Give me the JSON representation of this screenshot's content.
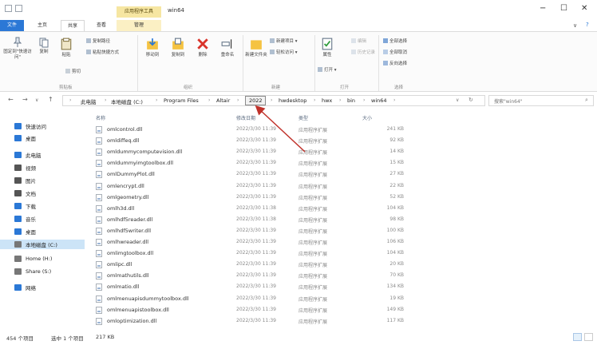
{
  "window": {
    "title": "win64",
    "context_tab": "应用程序工具",
    "minimize": "−",
    "maximize": "☐",
    "close": "✕",
    "collapse": "∨",
    "help": "?"
  },
  "ribbon_tabs": [
    {
      "label": "文件"
    },
    {
      "label": "主页"
    },
    {
      "label": "共享"
    },
    {
      "label": "查看"
    },
    {
      "label": "管理"
    }
  ],
  "ribbon": {
    "pin_label": "固定到\"快速访问\"",
    "copy_label": "复制",
    "paste_label": "粘贴",
    "copy_path": "复制路径",
    "paste_shortcut": "粘贴快捷方式",
    "cut": "剪切",
    "clipboard_group": "剪贴板",
    "move_to": "移动到",
    "copy_to": "复制到",
    "delete": "删除",
    "rename": "重命名",
    "organize_group": "组织",
    "new_folder": "新建文件夹",
    "new_item": "新建项目",
    "easy_access": "轻松访问",
    "new_group": "新建",
    "properties": "属性",
    "open": "打开",
    "edit": "编辑",
    "history": "历史记录",
    "open_group": "打开",
    "select_all": "全部选择",
    "select_none": "全部取消",
    "invert_selection": "反向选择",
    "select_group": "选择"
  },
  "address": {
    "crumbs": [
      "此电脑",
      "本地磁盘 (C:)",
      "Program Files",
      "Altair",
      "2022",
      "hwdesktop",
      "hwx",
      "bin",
      "win64"
    ],
    "search_placeholder": "搜索\"win64\"",
    "highlighted_crumb": "2022"
  },
  "nav_pane": [
    {
      "label": "快速访问",
      "icon": "star-icon",
      "color": "#2b78d6"
    },
    {
      "label": "桌面",
      "icon": "desktop-icon",
      "color": "#2b78d6"
    },
    {
      "label": "此电脑",
      "icon": "computer-icon",
      "color": "#2b78d6"
    },
    {
      "label": "视频",
      "icon": "video-icon",
      "color": "#555555"
    },
    {
      "label": "图片",
      "icon": "picture-icon",
      "color": "#555555"
    },
    {
      "label": "文档",
      "icon": "document-icon",
      "color": "#555555"
    },
    {
      "label": "下载",
      "icon": "download-icon",
      "color": "#2b78d6"
    },
    {
      "label": "音乐",
      "icon": "music-icon",
      "color": "#2b78d6"
    },
    {
      "label": "桌面",
      "icon": "desktop-icon",
      "color": "#2b78d6"
    },
    {
      "label": "本地磁盘 (C:)",
      "icon": "drive-icon",
      "color": "#777777"
    },
    {
      "label": "Home (H:)",
      "icon": "network-drive-icon",
      "color": "#777777"
    },
    {
      "label": "Share (S:)",
      "icon": "network-drive-icon",
      "color": "#777777"
    },
    {
      "label": "网络",
      "icon": "network-icon",
      "color": "#2b78d6"
    }
  ],
  "columns": {
    "name": "名称",
    "date": "修改日期",
    "type": "类型",
    "size": "大小"
  },
  "files": [
    {
      "name": "omlcontrol.dll",
      "date": "2022/3/30 11:39",
      "type": "应用程序扩展",
      "size": "241 KB"
    },
    {
      "name": "omldiffeq.dll",
      "date": "2022/3/30 11:39",
      "type": "应用程序扩展",
      "size": "92 KB"
    },
    {
      "name": "omldummycomputevision.dll",
      "date": "2022/3/30 11:39",
      "type": "应用程序扩展",
      "size": "14 KB"
    },
    {
      "name": "omldummyimgtoolbox.dll",
      "date": "2022/3/30 11:39",
      "type": "应用程序扩展",
      "size": "15 KB"
    },
    {
      "name": "omlDummyPlot.dll",
      "date": "2022/3/30 11:39",
      "type": "应用程序扩展",
      "size": "27 KB"
    },
    {
      "name": "omlencrypt.dll",
      "date": "2022/3/30 11:39",
      "type": "应用程序扩展",
      "size": "22 KB"
    },
    {
      "name": "omlgeometry.dll",
      "date": "2022/3/30 11:39",
      "type": "应用程序扩展",
      "size": "52 KB"
    },
    {
      "name": "omlh3d.dll",
      "date": "2022/3/30 11:38",
      "type": "应用程序扩展",
      "size": "104 KB"
    },
    {
      "name": "omlhdf5reader.dll",
      "date": "2022/3/30 11:38",
      "type": "应用程序扩展",
      "size": "98 KB"
    },
    {
      "name": "omlhdf5writer.dll",
      "date": "2022/3/30 11:39",
      "type": "应用程序扩展",
      "size": "100 KB"
    },
    {
      "name": "omlhwreader.dll",
      "date": "2022/3/30 11:39",
      "type": "应用程序扩展",
      "size": "106 KB"
    },
    {
      "name": "omlimgtoolbox.dll",
      "date": "2022/3/30 11:39",
      "type": "应用程序扩展",
      "size": "104 KB"
    },
    {
      "name": "omlipc.dll",
      "date": "2022/3/30 11:39",
      "type": "应用程序扩展",
      "size": "20 KB"
    },
    {
      "name": "omlmathutils.dll",
      "date": "2022/3/30 11:39",
      "type": "应用程序扩展",
      "size": "70 KB"
    },
    {
      "name": "omlmatio.dll",
      "date": "2022/3/30 11:39",
      "type": "应用程序扩展",
      "size": "134 KB"
    },
    {
      "name": "omlmenuapisdummytoolbox.dll",
      "date": "2022/3/30 11:39",
      "type": "应用程序扩展",
      "size": "19 KB"
    },
    {
      "name": "omlmenuapistoolbox.dll",
      "date": "2022/3/30 11:39",
      "type": "应用程序扩展",
      "size": "149 KB"
    },
    {
      "name": "omloptimization.dll",
      "date": "2022/3/30 11:39",
      "type": "应用程序扩展",
      "size": "117 KB"
    }
  ],
  "status": {
    "item_count": "454 个项目",
    "selected": "选中 1 个项目",
    "selected_size": "217 KB"
  },
  "colors": {
    "accent": "#2b78d6",
    "annotation_arrow": "#c0322b",
    "selection": "#cce4f7"
  }
}
